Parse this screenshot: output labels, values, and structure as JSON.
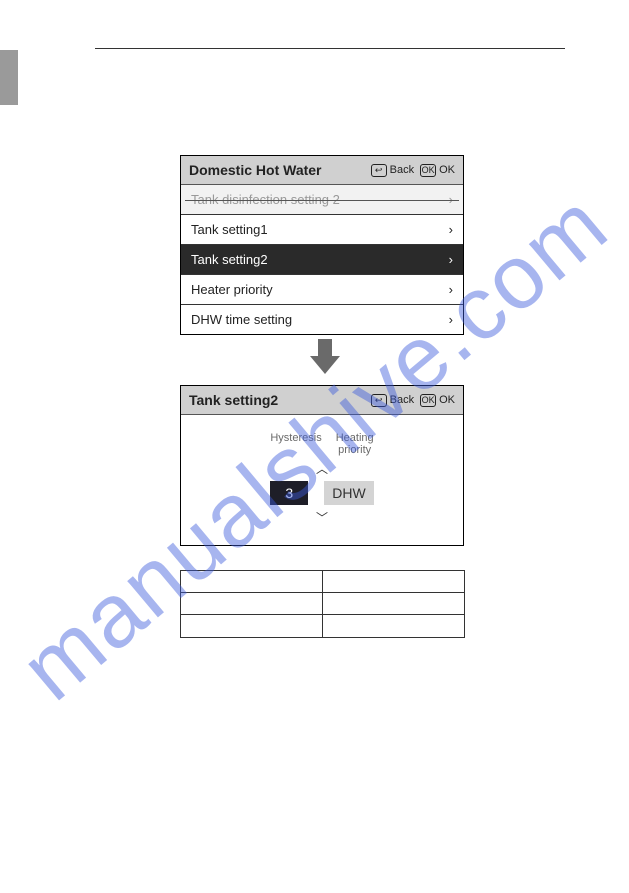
{
  "watermark": "manualshive.com",
  "panel1": {
    "title": "Domestic Hot Water",
    "back_icon": "↩",
    "back_label": "Back",
    "ok_icon": "OK",
    "ok_label": "OK",
    "items": [
      {
        "label": "Tank disinfection setting 2",
        "type": "cut"
      },
      {
        "label": "Tank setting1",
        "type": "normal"
      },
      {
        "label": "Tank setting2",
        "type": "selected"
      },
      {
        "label": "Heater priority",
        "type": "normal"
      },
      {
        "label": "DHW time setting",
        "type": "normal"
      }
    ],
    "chevron": "›"
  },
  "panel2": {
    "title": "Tank setting2",
    "back_icon": "↩",
    "back_label": "Back",
    "ok_icon": "OK",
    "ok_label": "OK",
    "labels": {
      "hysteresis": "Hysteresis",
      "heating_priority_line1": "Heating",
      "heating_priority_line2": "priority"
    },
    "caret_up": "︿",
    "caret_down": "﹀",
    "values": {
      "hysteresis": "3",
      "heating_priority": "DHW"
    }
  }
}
